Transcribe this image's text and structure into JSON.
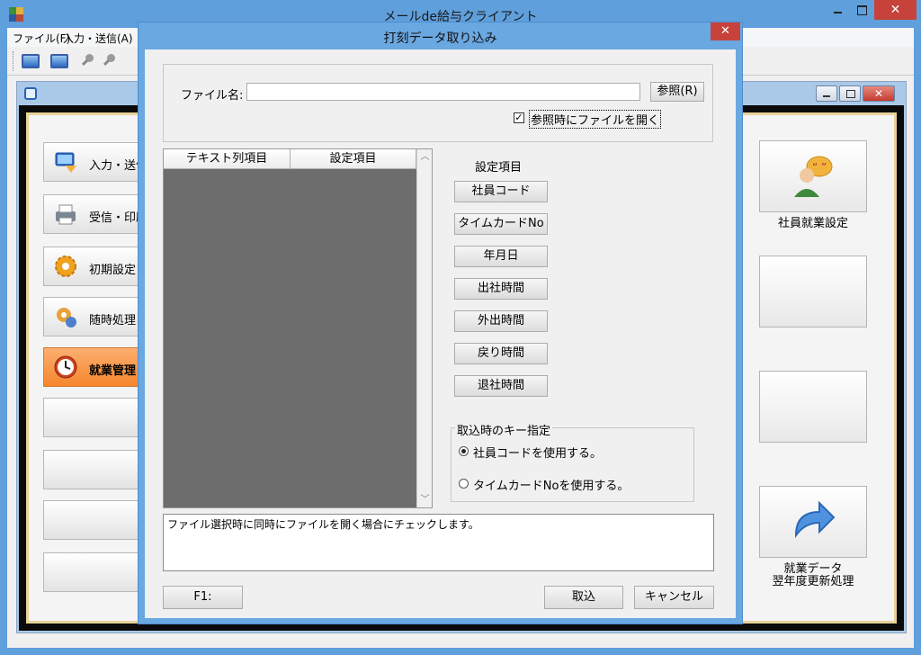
{
  "app": {
    "title": "メールde給与クライアント",
    "close_glyph": "✕"
  },
  "menubar": {
    "items": [
      {
        "label": "ファイル(F)"
      },
      {
        "label": "入力・送信(A)"
      }
    ]
  },
  "mdi": {
    "close_glyph": "✕"
  },
  "left_menu": {
    "items": [
      {
        "label": "入力・送信",
        "icon": "monitor-icon"
      },
      {
        "label": "受信・印刷",
        "icon": "printer-icon"
      },
      {
        "label": "初期設定",
        "icon": "gear-icon"
      },
      {
        "label": "随時処理",
        "icon": "tools-icon"
      },
      {
        "label": "就業管理",
        "icon": "clock-icon",
        "active": true
      }
    ]
  },
  "right_panel": {
    "tiles": [
      {
        "label": "社員就業設定",
        "icon": "employee-speech-icon"
      },
      {
        "label": "",
        "icon": ""
      },
      {
        "label": "",
        "icon": ""
      },
      {
        "label": "就業データ\n翌年度更新処理",
        "line1": "就業データ",
        "line2": "翌年度更新処理",
        "icon": "arrow-icon"
      }
    ]
  },
  "dialog": {
    "title": "打刻データ取り込み",
    "close_glyph": "✕",
    "file_label": "ファイル名:",
    "file_value": "",
    "browse_label": "参照(R)",
    "checkbox_checked": true,
    "checkbox_label": "参照時にファイルを開く",
    "grid": {
      "columns": [
        "テキスト列項目",
        "設定項目"
      ],
      "scroll_up": "︿",
      "scroll_down": "﹀"
    },
    "settings_title": "設定項目",
    "settings": [
      "社員コード",
      "タイムカードNo",
      "年月日",
      "出社時間",
      "外出時間",
      "戻り時間",
      "退社時間"
    ],
    "key_group": {
      "legend": "取込時のキー指定",
      "options": [
        {
          "label": "社員コードを使用する。",
          "selected": true
        },
        {
          "label": "タイムカードNoを使用する。",
          "selected": false
        }
      ]
    },
    "help_text": "ファイル選択時に同時にファイルを開く場合にチェックします。",
    "buttons": {
      "f1": "F1:",
      "ok": "取込",
      "cancel": "キャンセル"
    }
  },
  "colors": {
    "titlebar": "#5f9fdc",
    "close_red": "#c7423a",
    "active_orange": "#f6862d",
    "grid_bg": "#6d6d6d"
  }
}
